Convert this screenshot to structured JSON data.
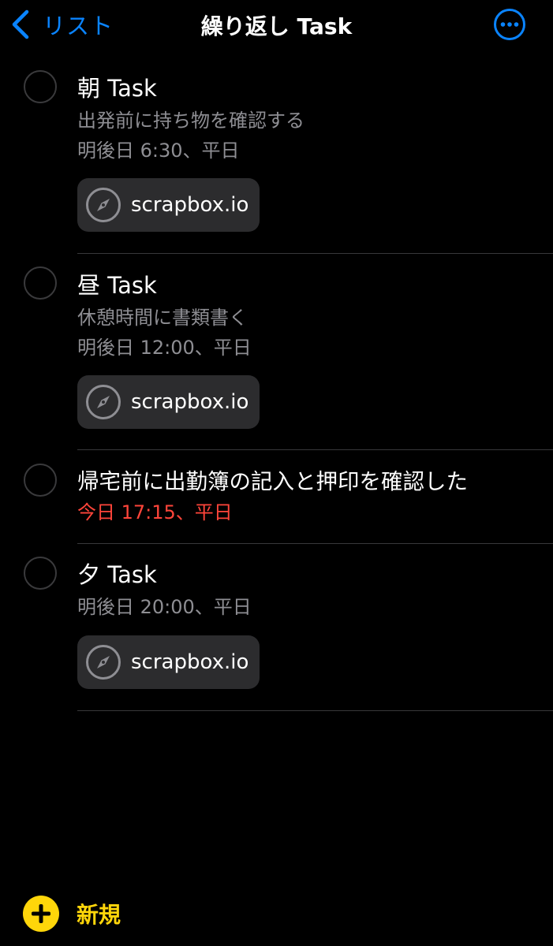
{
  "colors": {
    "background": "#000000",
    "accent_blue": "#0a84ff",
    "accent_yellow": "#ffd60a",
    "overdue_red": "#ff453a",
    "secondary_text": "#8e8e93",
    "chip_background": "#2c2c2e"
  },
  "nav": {
    "back_label": "リスト",
    "back_icon": "chevron-left-icon",
    "title": "繰り返し Task",
    "more_icon": "ellipsis-circle-icon"
  },
  "tasks": [
    {
      "title": "朝 Task",
      "notes": "出発前に持ち物を確認する",
      "due": "明後日 6:30、平日",
      "overdue": false,
      "link": {
        "label": "scrapbox.io",
        "icon": "compass-icon"
      }
    },
    {
      "title": "昼 Task",
      "notes": "休憩時間に書類書く",
      "due": "明後日 12:00、平日",
      "overdue": false,
      "link": {
        "label": "scrapbox.io",
        "icon": "compass-icon"
      }
    },
    {
      "title": "帰宅前に出勤簿の記入と押印を確認した",
      "due": "今日 17:15、平日",
      "overdue": true
    },
    {
      "title": "夕 Task",
      "due": "明後日 20:00、平日",
      "overdue": false,
      "link": {
        "label": "scrapbox.io",
        "icon": "compass-icon"
      }
    }
  ],
  "footer": {
    "new_label": "新規",
    "new_icon": "plus-circle-icon"
  }
}
